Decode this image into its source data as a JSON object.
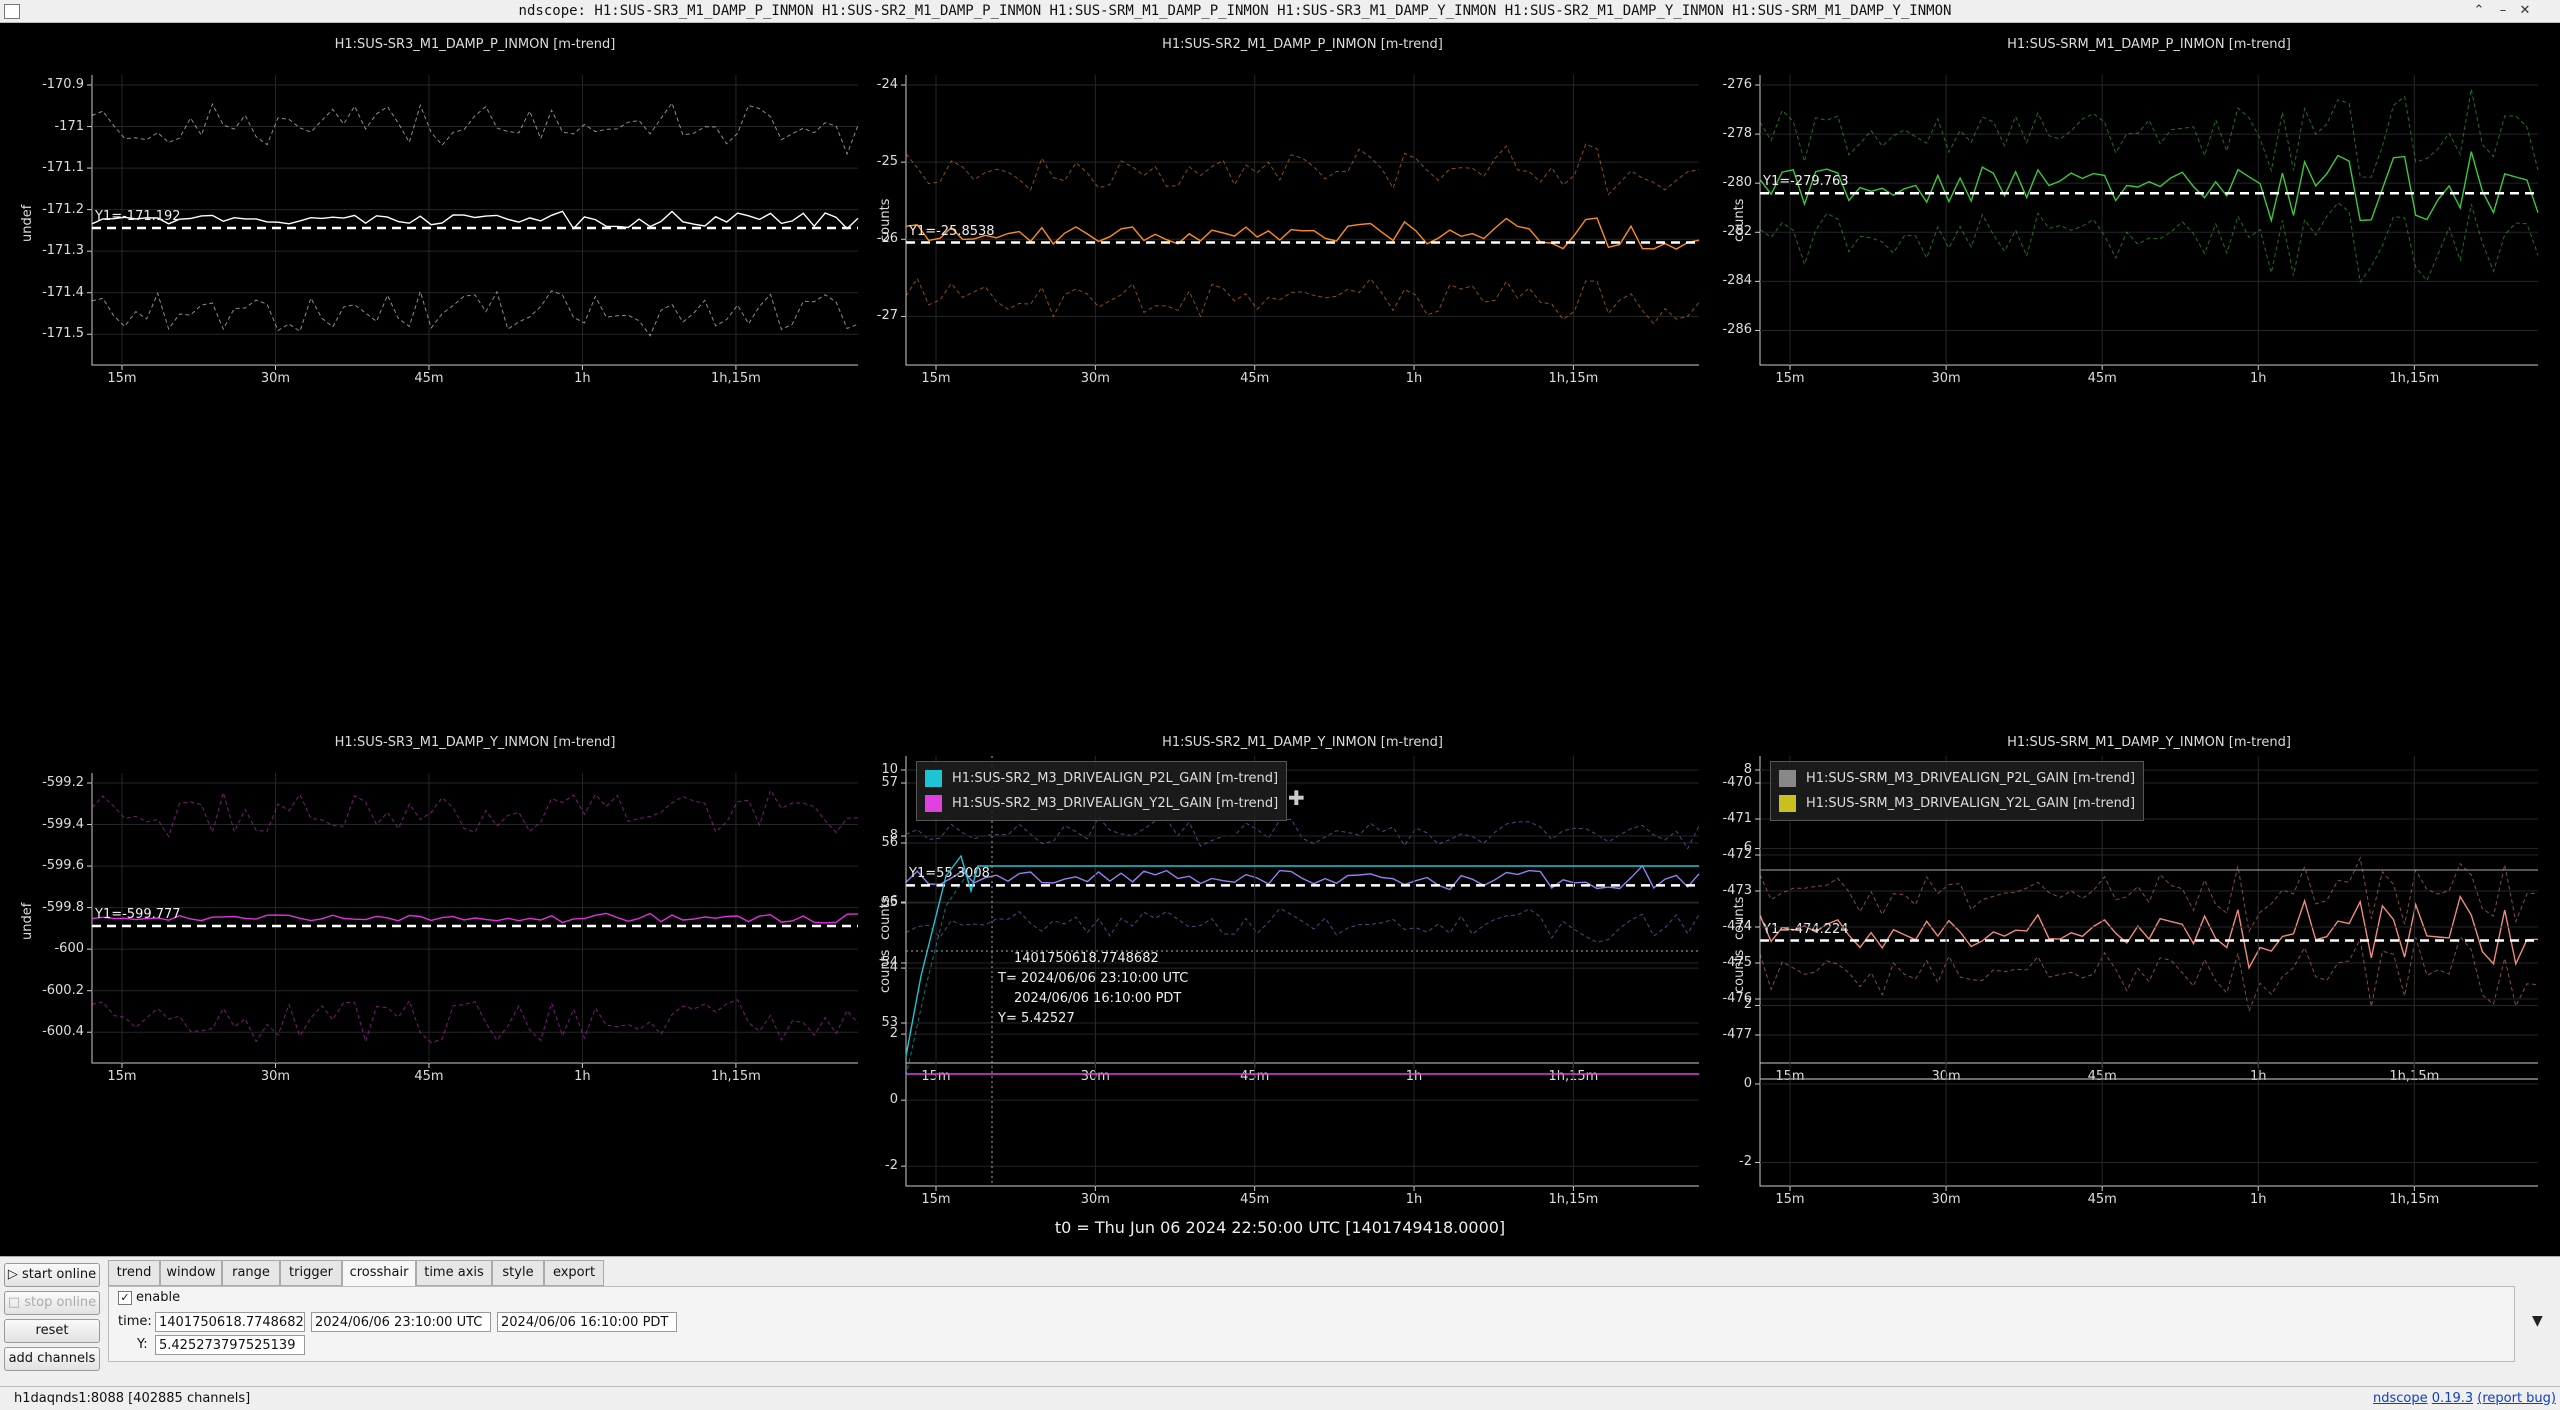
{
  "window": {
    "title": "ndscope: H1:SUS-SR3_M1_DAMP_P_INMON H1:SUS-SR2_M1_DAMP_P_INMON H1:SUS-SRM_M1_DAMP_P_INMON H1:SUS-SR3_M1_DAMP_Y_INMON H1:SUS-SR2_M1_DAMP_Y_INMON H1:SUS-SRM_M1_DAMP_Y_INMON",
    "buttons": [
      "⌃",
      "–",
      "✕"
    ]
  },
  "x_ticks": [
    "15m",
    "30m",
    "45m",
    "1h",
    "1h,15m"
  ],
  "plots": [
    {
      "title": "H1:SUS-SR3_M1_DAMP_P_INMON [m-trend]",
      "ylabel": "undef",
      "yticks": [
        "-170.9",
        "-171",
        "-171.1",
        "-171.2",
        "-171.3",
        "-171.4",
        "-171.5"
      ],
      "y1": "Y1=-171.192",
      "color": "#ffffff"
    },
    {
      "title": "H1:SUS-SR2_M1_DAMP_P_INMON [m-trend]",
      "ylabel": "counts",
      "yticks": [
        "-24",
        "-25",
        "-26",
        "-27"
      ],
      "y1": "Y1=-25.8538",
      "color": "#ff8c1a"
    },
    {
      "title": "H1:SUS-SRM_M1_DAMP_P_INMON [m-trend]",
      "ylabel": "counts",
      "yticks": [
        "-276",
        "-278",
        "-280",
        "-282",
        "-284",
        "-286"
      ],
      "y1": "Y1=-279.763",
      "color": "#3cc83c"
    },
    {
      "title": "H1:SUS-SR3_M1_DAMP_Y_INMON [m-trend]",
      "ylabel": "undef",
      "yticks": [
        "-599.2",
        "-599.4",
        "-599.6",
        "-599.8",
        "-600",
        "-600.2",
        "-600.4"
      ],
      "y1": "Y1=-599.777",
      "color": "#e030e0"
    },
    {
      "title": "H1:SUS-SR2_M1_DAMP_Y_INMON [m-trend]",
      "ylabel": "counts",
      "yticks": [
        "57",
        "56",
        "55",
        "54",
        "53"
      ],
      "y1": "Y1=55.3008",
      "color": "#9a7cf0"
    },
    {
      "title": "H1:SUS-SRM_M1_DAMP_Y_INMON [m-trend]",
      "ylabel": "counts",
      "yticks": [
        "-470",
        "-471",
        "-472",
        "-473",
        "-474",
        "-475",
        "-476",
        "-477"
      ],
      "y1": "Y1=-474.224",
      "color": "#f08a7c"
    },
    {
      "title": "",
      "ylabel": "counts",
      "yticks": [
        "10",
        "8",
        "6",
        "4",
        "2",
        "0",
        "-2"
      ],
      "y1": "",
      "color": "#20c8d8",
      "legend": [
        {
          "label": "H1:SUS-SR2_M3_DRIVEALIGN_P2L_GAIN [m-trend]",
          "color": "#1cc4d4"
        },
        {
          "label": "H1:SUS-SR2_M3_DRIVEALIGN_Y2L_GAIN [m-trend]",
          "color": "#e040e0"
        }
      ]
    },
    {
      "title": "",
      "ylabel": "counts",
      "yticks": [
        "8",
        "6",
        "4",
        "2",
        "0",
        "-2"
      ],
      "y1": "",
      "color": "#aaaaaa",
      "legend": [
        {
          "label": "H1:SUS-SRM_M3_DRIVEALIGN_P2L_GAIN [m-trend]",
          "color": "#888888"
        },
        {
          "label": "H1:SUS-SRM_M3_DRIVEALIGN_Y2L_GAIN [m-trend]",
          "color": "#c8c020"
        }
      ]
    }
  ],
  "crosshair_readout": {
    "gps": "1401750618.7748682",
    "t_utc": "T= 2024/06/06 23:10:00 UTC",
    "t_pdt": "2024/06/06 16:10:00 PDT",
    "y": "Y= 5.42527"
  },
  "t0_label": "t0 = Thu Jun 06 2024 22:50:00 UTC [1401749418.0000]",
  "left_buttons": {
    "start_online": "▷ start online",
    "stop_online": "□ stop online",
    "reset": "reset",
    "add_channels": "add channels"
  },
  "tabs": [
    "trend",
    "window",
    "range",
    "trigger",
    "crosshair",
    "time axis",
    "style",
    "export"
  ],
  "active_tab": "crosshair",
  "crosshair_panel": {
    "enable_check": "✓",
    "enable_label": "enable",
    "time_label": "time:",
    "time_gps": "1401750618.7748682",
    "time_utc": "2024/06/06 23:10:00 UTC",
    "time_pdt": "2024/06/06 16:10:00 PDT",
    "y_label": "Y:",
    "y_value": "5.425273797525139"
  },
  "collapse_arrow": "▼",
  "status": {
    "server": "h1daqnds1:8088  [402885 channels]",
    "app": "ndscope",
    "version": "0.19.3",
    "report_bug": "(report bug)"
  }
}
